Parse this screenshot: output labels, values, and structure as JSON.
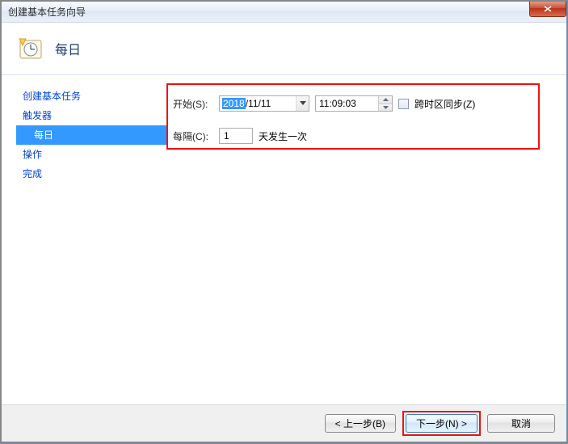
{
  "window": {
    "title": "创建基本任务向导"
  },
  "header": {
    "title": "每日"
  },
  "sidebar": {
    "items": [
      {
        "label": "创建基本任务",
        "child": false,
        "active": false
      },
      {
        "label": "触发器",
        "child": false,
        "active": false
      },
      {
        "label": "每日",
        "child": true,
        "active": true
      },
      {
        "label": "操作",
        "child": false,
        "active": false
      },
      {
        "label": "完成",
        "child": false,
        "active": false
      }
    ]
  },
  "form": {
    "start_label": "开始(S):",
    "date_selected": "2018",
    "date_rest": "/11/11",
    "time_value": "11:09:03",
    "sync_label": "跨时区同步(Z)",
    "interval_label": "每隔(C):",
    "interval_value": "1",
    "interval_suffix": "天发生一次"
  },
  "buttons": {
    "back": "< 上一步(B)",
    "next": "下一步(N) >",
    "cancel": "取消"
  }
}
